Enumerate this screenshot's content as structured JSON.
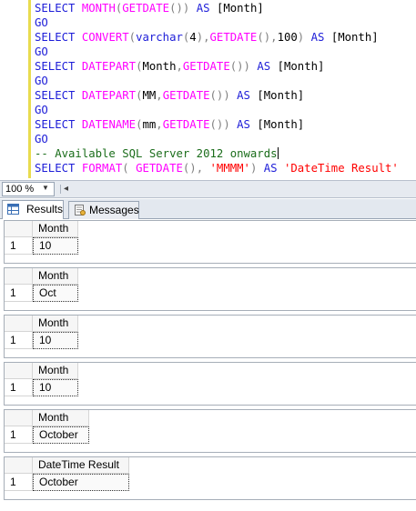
{
  "editor": {
    "lines": [
      [
        {
          "c": "kw",
          "t": "SELECT "
        },
        {
          "c": "fn",
          "t": "MONTH"
        },
        {
          "c": "op",
          "t": "("
        },
        {
          "c": "fn",
          "t": "GETDATE"
        },
        {
          "c": "op",
          "t": "())"
        },
        {
          "c": "kw",
          "t": " AS "
        },
        {
          "c": "tx",
          "t": "[Month]"
        }
      ],
      [
        {
          "c": "kw",
          "t": "GO"
        }
      ],
      [
        {
          "c": "kw",
          "t": "SELECT "
        },
        {
          "c": "fn",
          "t": "CONVERT"
        },
        {
          "c": "op",
          "t": "("
        },
        {
          "c": "kw",
          "t": "varchar"
        },
        {
          "c": "op",
          "t": "("
        },
        {
          "c": "tx",
          "t": "4"
        },
        {
          "c": "op",
          "t": "),"
        },
        {
          "c": "fn",
          "t": "GETDATE"
        },
        {
          "c": "op",
          "t": "(),"
        },
        {
          "c": "tx",
          "t": "100"
        },
        {
          "c": "op",
          "t": ")"
        },
        {
          "c": "kw",
          "t": " AS "
        },
        {
          "c": "tx",
          "t": "[Month]"
        }
      ],
      [
        {
          "c": "kw",
          "t": "GO"
        }
      ],
      [
        {
          "c": "kw",
          "t": "SELECT "
        },
        {
          "c": "fn",
          "t": "DATEPART"
        },
        {
          "c": "op",
          "t": "("
        },
        {
          "c": "tx",
          "t": "Month"
        },
        {
          "c": "op",
          "t": ","
        },
        {
          "c": "fn",
          "t": "GETDATE"
        },
        {
          "c": "op",
          "t": "())"
        },
        {
          "c": "kw",
          "t": " AS "
        },
        {
          "c": "tx",
          "t": "[Month]"
        }
      ],
      [
        {
          "c": "kw",
          "t": "GO"
        }
      ],
      [
        {
          "c": "kw",
          "t": "SELECT "
        },
        {
          "c": "fn",
          "t": "DATEPART"
        },
        {
          "c": "op",
          "t": "("
        },
        {
          "c": "tx",
          "t": "MM"
        },
        {
          "c": "op",
          "t": ","
        },
        {
          "c": "fn",
          "t": "GETDATE"
        },
        {
          "c": "op",
          "t": "())"
        },
        {
          "c": "kw",
          "t": " AS "
        },
        {
          "c": "tx",
          "t": "[Month]"
        }
      ],
      [
        {
          "c": "kw",
          "t": "GO"
        }
      ],
      [
        {
          "c": "kw",
          "t": "SELECT "
        },
        {
          "c": "fn",
          "t": "DATENAME"
        },
        {
          "c": "op",
          "t": "("
        },
        {
          "c": "tx",
          "t": "mm"
        },
        {
          "c": "op",
          "t": ","
        },
        {
          "c": "fn",
          "t": "GETDATE"
        },
        {
          "c": "op",
          "t": "())"
        },
        {
          "c": "kw",
          "t": " AS "
        },
        {
          "c": "tx",
          "t": "[Month]"
        }
      ],
      [
        {
          "c": "kw",
          "t": "GO"
        }
      ],
      [
        {
          "c": "gr",
          "t": "-- Available SQL Server 2012 onwards"
        },
        {
          "c": "caret",
          "t": ""
        }
      ],
      [
        {
          "c": "kw",
          "t": "SELECT "
        },
        {
          "c": "fn",
          "t": "FORMAT"
        },
        {
          "c": "op",
          "t": "("
        },
        {
          "c": "tx",
          "t": " "
        },
        {
          "c": "fn",
          "t": "GETDATE"
        },
        {
          "c": "op",
          "t": "(),"
        },
        {
          "c": "tx",
          "t": " "
        },
        {
          "c": "st",
          "t": "'MMMM'"
        },
        {
          "c": "op",
          "t": ")"
        },
        {
          "c": "kw",
          "t": " AS "
        },
        {
          "c": "st",
          "t": "'DateTime Result'"
        }
      ]
    ]
  },
  "toolbar": {
    "zoom_value": "100 %",
    "zoom_arrow": "▼",
    "scroll_left": "◂"
  },
  "tabs": {
    "results_label": "Results",
    "messages_label": "Messages"
  },
  "grids": [
    {
      "header": "Month",
      "row": "1",
      "value": "10"
    },
    {
      "header": "Month",
      "row": "1",
      "value": "Oct"
    },
    {
      "header": "Month",
      "row": "1",
      "value": "10"
    },
    {
      "header": "Month",
      "row": "1",
      "value": "10"
    },
    {
      "header": "Month",
      "row": "1",
      "value": "October"
    },
    {
      "header": "DateTime Result",
      "row": "1",
      "value": "October"
    }
  ]
}
